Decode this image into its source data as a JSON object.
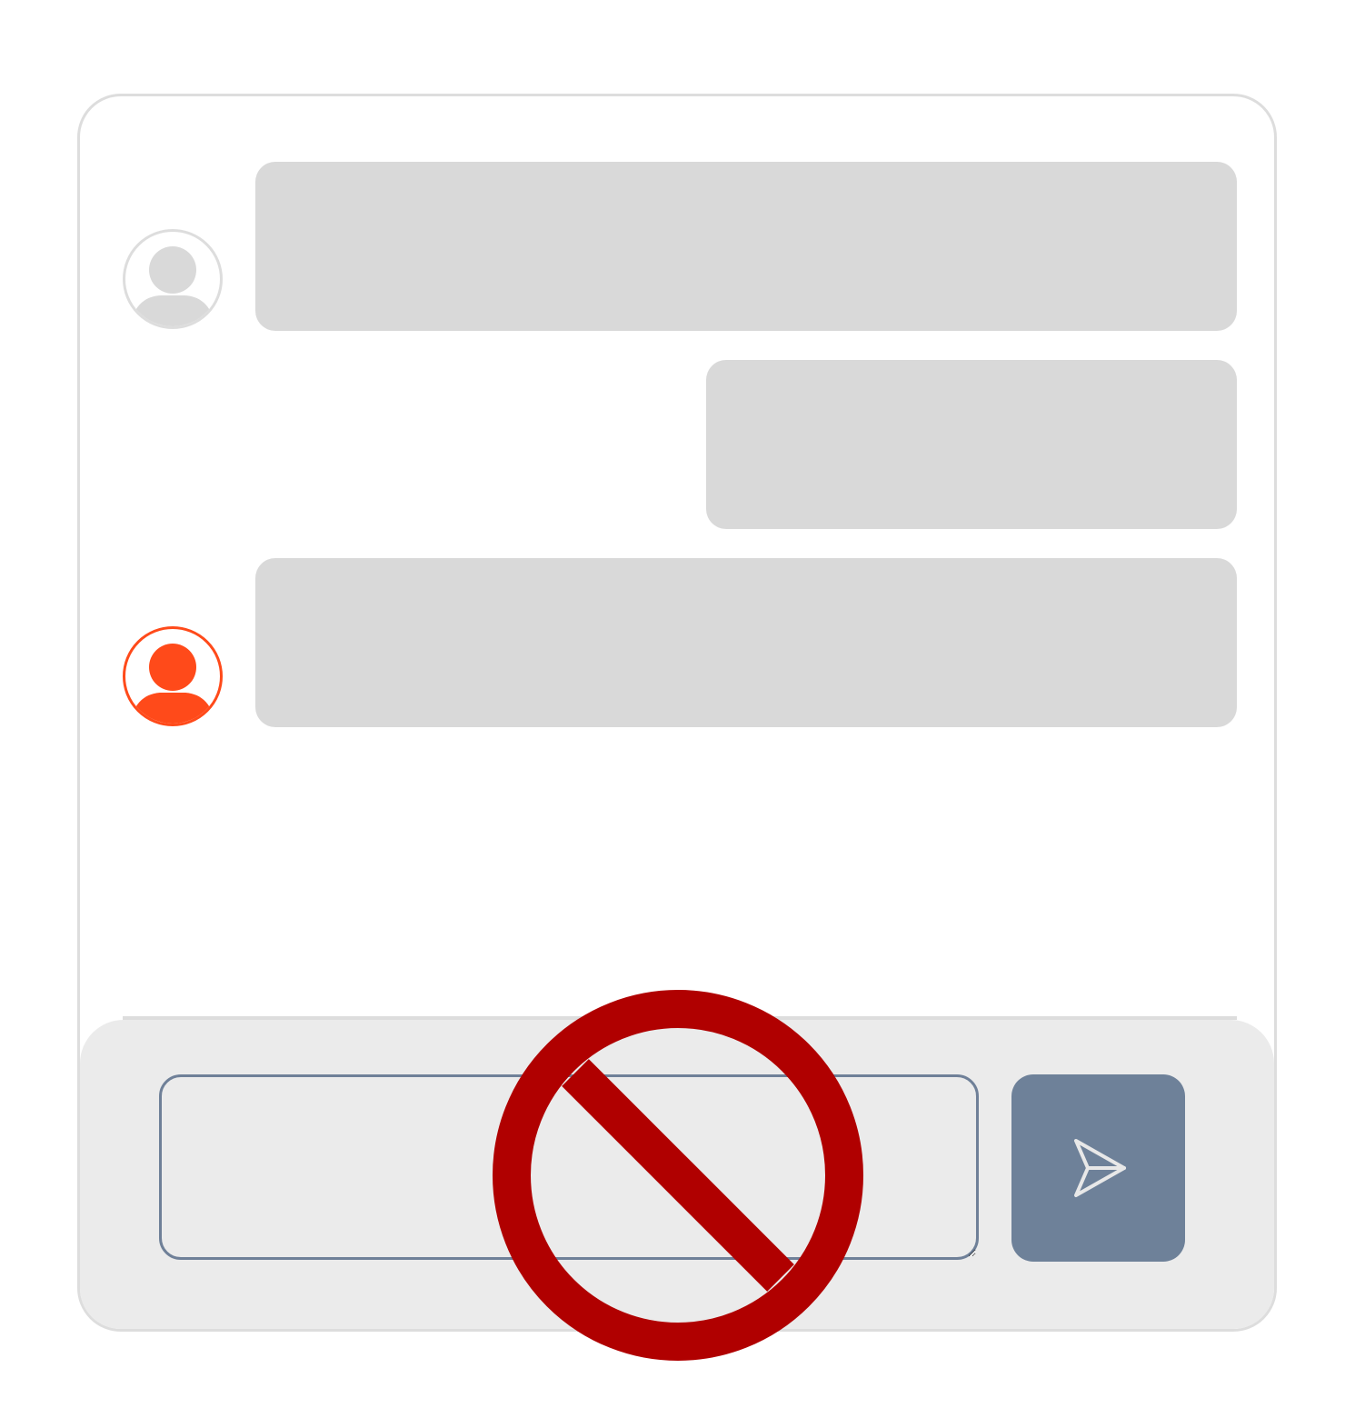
{
  "chat": {
    "messages": [
      {
        "sender": "other",
        "text": ""
      },
      {
        "sender": "self",
        "text": ""
      },
      {
        "sender": "self",
        "text": ""
      }
    ]
  },
  "composer": {
    "input_value": "",
    "input_placeholder": "",
    "send_icon": "send-icon"
  },
  "overlay": {
    "icon": "prohibited-icon",
    "color": "#b00000"
  },
  "colors": {
    "avatar_other": "#dddddd",
    "avatar_self": "#ff4a1a",
    "bubble": "#d9d9d9",
    "composer_background": "#ebebeb",
    "send_button": "#6e8199",
    "border": "#dddddd"
  }
}
